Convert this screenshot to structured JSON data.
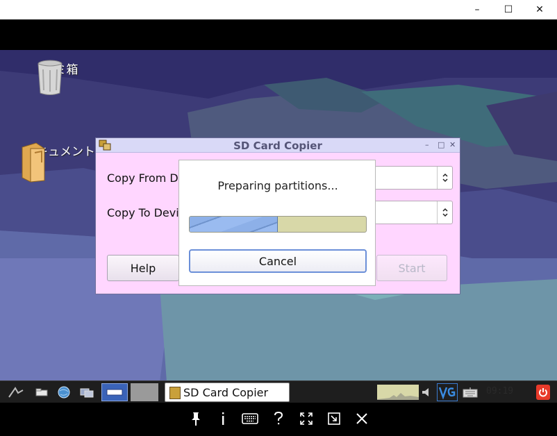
{
  "window_controls": {
    "minimize": "–",
    "maximize": "☐",
    "close": "✕"
  },
  "desktop": {
    "icons": [
      {
        "label": "ゴミ箱",
        "icon": "trash-can-icon"
      },
      {
        "label": "ドキュメント",
        "icon": "folder-documents-icon"
      }
    ]
  },
  "sd_window": {
    "title": "SD Card Copier",
    "controls": {
      "minimize": "–",
      "maximize": "□",
      "close": "✕"
    },
    "copy_from_label": "Copy From D",
    "copy_to_label": "Copy To Devi",
    "help_label": "Help",
    "start_label": "Start"
  },
  "progress_dialog": {
    "message": "Preparing partitions...",
    "progress_fraction": 0.5,
    "cancel_label": "Cancel"
  },
  "taskbar": {
    "task_label": "SD Card Copier",
    "clock": "09:19"
  },
  "colors": {
    "dialog_background": "#ffd6ff",
    "titlebar_background": "#d9d9f7",
    "progress_fill": "#8db0e8",
    "progress_track": "#d8d8a8",
    "taskbar_background": "#1e1e1e",
    "power_red": "#e83a2a"
  }
}
